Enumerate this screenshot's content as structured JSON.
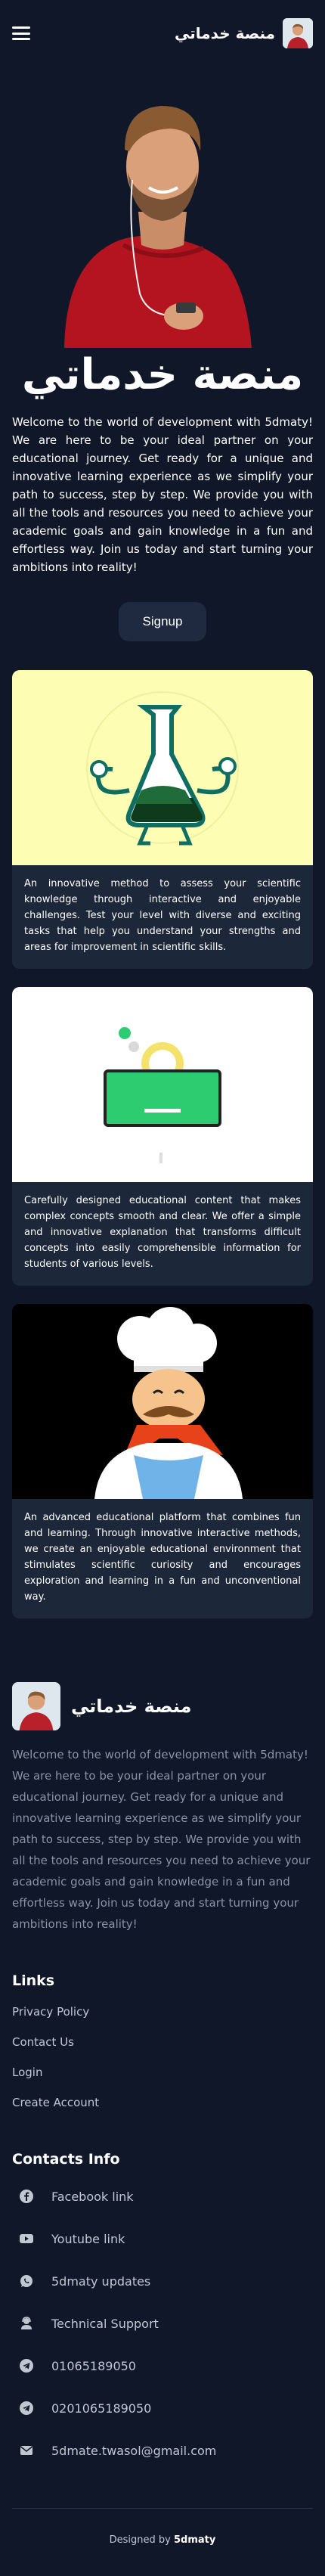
{
  "header": {
    "brand_name": "منصة خدماتي",
    "menu_icon": "hamburger-icon"
  },
  "hero": {
    "title": "منصة خدماتي",
    "text": "Welcome to the world of development with 5dmaty! We are here to be your ideal partner on your educational journey. Get ready for a unique and innovative learning experience as we simplify your path to success, step by step. We provide you with all the tools and resources you need to achieve your academic goals and gain knowledge in a fun and effortless way. Join us today and start turning your ambitions into reality!",
    "signup_label": "Signup"
  },
  "cards": [
    {
      "text": "An innovative method to assess your scientific knowledge through interactive and enjoyable challenges. Test your level with diverse and exciting tasks that help you understand your strengths and areas for improvement in scientific skills.",
      "bg": "#fdfdb3"
    },
    {
      "text": "Carefully designed educational content that makes complex concepts smooth and clear. We offer a simple and innovative explanation that transforms difficult concepts into easily comprehensible information for students of various levels.",
      "bg": "#ffffff"
    },
    {
      "text": "An advanced educational platform that combines fun and learning. Through innovative interactive methods, we create an enjoyable educational environment that stimulates scientific curiosity and encourages exploration and learning in a fun and unconventional way.",
      "bg": "#000000"
    }
  ],
  "footer": {
    "brand_name": "منصة خدماتي",
    "description": "Welcome to the world of development with 5dmaty! We are here to be your ideal partner on your educational journey. Get ready for a unique and innovative learning experience as we simplify your path to success, step by step. We provide you with all the tools and resources you need to achieve your academic goals and gain knowledge in a fun and effortless way. Join us today and start turning your ambitions into reality!",
    "links_heading": "Links",
    "links": [
      "Privacy Policy",
      "Contact Us",
      "Login",
      "Create Account"
    ],
    "contacts_heading": "Contacts Info",
    "contacts": [
      {
        "icon": "facebook-icon",
        "label": "Facebook link"
      },
      {
        "icon": "youtube-icon",
        "label": "Youtube link"
      },
      {
        "icon": "whatsapp-icon",
        "label": "5dmaty updates"
      },
      {
        "icon": "support-icon",
        "label": "Technical Support"
      },
      {
        "icon": "telegram-icon",
        "label": "01065189050"
      },
      {
        "icon": "telegram-icon",
        "label": "0201065189050"
      },
      {
        "icon": "email-icon",
        "label": "5dmate.twasol@gmail.com"
      }
    ],
    "credit_prefix": "Designed by",
    "credit_name": "5dmaty"
  },
  "colors": {
    "background": "#0f1729",
    "surface": "#1d273a",
    "button": "#1f2a40",
    "muted_text": "#8a93a6"
  }
}
